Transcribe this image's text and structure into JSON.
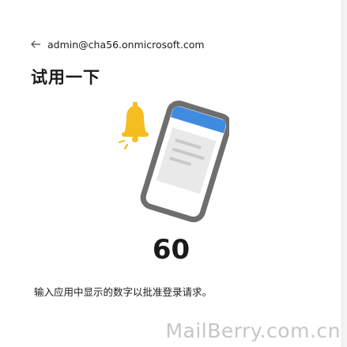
{
  "header": {
    "back_icon": "arrow-left-icon",
    "account": "admin@cha56.onmicrosoft.com"
  },
  "main": {
    "title": "试用一下",
    "illustration_icons": [
      "bell-icon",
      "phone-icon"
    ],
    "colors": {
      "bell": "#f5be1e",
      "phone_header": "#3f8be0",
      "phone_frame": "#6e6e6e"
    },
    "number": "60",
    "instruction": "输入应用中显示的数字以批准登录请求。"
  },
  "watermark": "MailBerry.com.cn"
}
